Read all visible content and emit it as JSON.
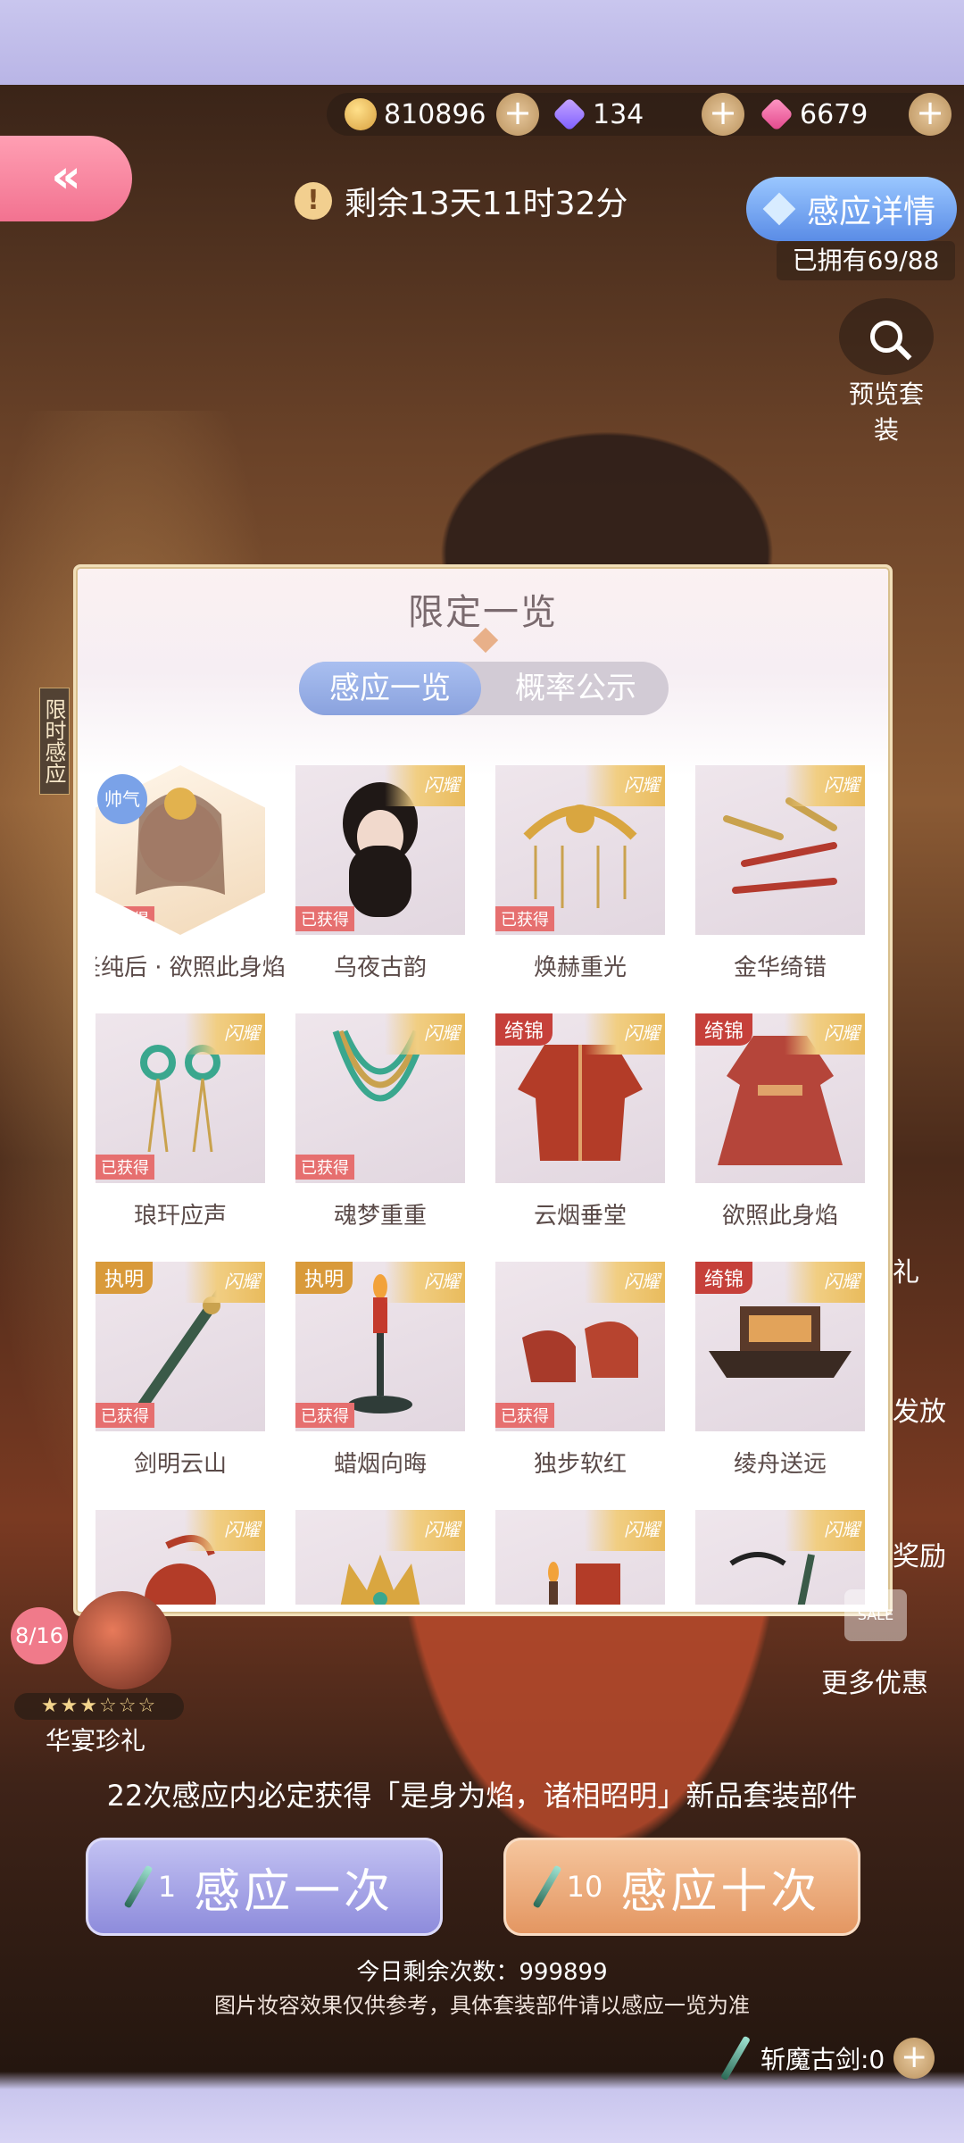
{
  "currency": {
    "coins": "810896",
    "gems_purple": "134",
    "gems_pink": "6679",
    "plus_symbol": "+"
  },
  "header": {
    "back_symbol": "«",
    "timer_warn_symbol": "!",
    "timer_text": "剩余13天11时32分",
    "detail_button": "感应详情",
    "owned_text": "已拥有69/88",
    "preview_label": "预览套装",
    "limited_tag": "限时感应"
  },
  "side_labels": [
    "礼",
    "发放",
    "奖励"
  ],
  "popup": {
    "title": "限定一览",
    "tab_active": "感应一览",
    "tab_inactive": "概率公示",
    "items": [
      {
        "name": "圣纯后 · 欲照此身焰",
        "corner": "",
        "tag": "帅气",
        "obtained": "已获得",
        "hex": true
      },
      {
        "name": "乌夜古韵",
        "corner": "闪耀",
        "tag": "",
        "obtained": "已获得"
      },
      {
        "name": "焕赫重光",
        "corner": "闪耀",
        "tag": "",
        "obtained": "已获得"
      },
      {
        "name": "金华绮错",
        "corner": "闪耀",
        "tag": "",
        "obtained": ""
      },
      {
        "name": "琅玕应声",
        "corner": "闪耀",
        "tag": "",
        "obtained": "已获得"
      },
      {
        "name": "魂梦重重",
        "corner": "闪耀",
        "tag": "",
        "obtained": "已获得"
      },
      {
        "name": "云烟垂堂",
        "corner": "闪耀",
        "tag": "绮锦",
        "obtained": ""
      },
      {
        "name": "欲照此身焰",
        "corner": "闪耀",
        "tag": "绮锦",
        "obtained": ""
      },
      {
        "name": "剑明云山",
        "corner": "闪耀",
        "tag": "执明",
        "obtained": "已获得"
      },
      {
        "name": "蜡烟向晦",
        "corner": "闪耀",
        "tag": "执明",
        "obtained": "已获得"
      },
      {
        "name": "独步软红",
        "corner": "闪耀",
        "tag": "",
        "obtained": "已获得"
      },
      {
        "name": "绫舟送远",
        "corner": "闪耀",
        "tag": "绮锦",
        "obtained": ""
      },
      {
        "name": "",
        "corner": "闪耀",
        "tag": "",
        "obtained": ""
      },
      {
        "name": "",
        "corner": "闪耀",
        "tag": "",
        "obtained": ""
      },
      {
        "name": "",
        "corner": "闪耀",
        "tag": "",
        "obtained": ""
      },
      {
        "name": "",
        "corner": "闪耀",
        "tag": "",
        "obtained": ""
      }
    ]
  },
  "bonus": {
    "count": "8/16",
    "stars": "★★★☆☆☆",
    "label": "华宴珍礼"
  },
  "more_deals": {
    "badge": "SALE",
    "label": "更多优惠"
  },
  "guarantee_text": "22次感应内必定获得「是身为焰，诸相昭明」新品套装部件",
  "pull_once": {
    "num": "1",
    "label": "感应一次"
  },
  "pull_ten": {
    "num": "10",
    "label": "感应十次"
  },
  "remaining_today": "今日剩余次数：999899",
  "disclaimer": "图片妆容效果仅供参考，具体套装部件请以感应一览为准",
  "sword_currency": "斩魔古剑:0",
  "colors": {
    "accent_pink": "#f27290",
    "accent_blue": "#5a8ce6",
    "obtained_red": "#e66f6f",
    "gold": "#f1ce83"
  }
}
